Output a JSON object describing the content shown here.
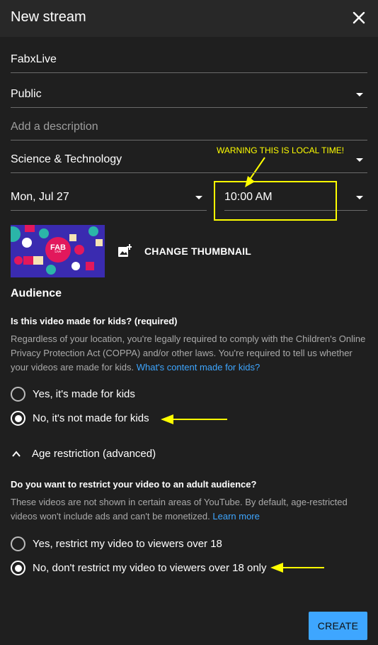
{
  "dialog": {
    "title": "New stream"
  },
  "form": {
    "title_value": "FabxLive",
    "visibility": "Public",
    "description_placeholder": "Add a description",
    "category": "Science & Technology",
    "date": "Mon, Jul 27",
    "time": "10:00 AM"
  },
  "annotation": {
    "warning": "WARNING THIS IS LOCAL TIME!",
    "color": "#ffff00"
  },
  "thumbnail": {
    "logo_text": "FAB",
    "logo_sub": "Live",
    "change_label": "CHANGE THUMBNAIL"
  },
  "audience": {
    "heading": "Audience",
    "question": "Is this video made for kids? (required)",
    "description": "Regardless of your location, you're legally required to comply with the Children's Online Privacy Protection Act (COPPA) and/or other laws. You're required to tell us whether your videos are made for kids.",
    "link": "What's content made for kids?",
    "options": [
      {
        "label": "Yes, it's made for kids",
        "selected": false
      },
      {
        "label": "No, it's not made for kids",
        "selected": true
      }
    ]
  },
  "age_restriction": {
    "toggle_label": "Age restriction (advanced)",
    "question": "Do you want to restrict your video to an adult audience?",
    "description": "These videos are not shown in certain areas of YouTube. By default, age-restricted videos won't include ads and can't be monetized.",
    "link": "Learn more",
    "options": [
      {
        "label": "Yes, restrict my video to viewers over 18",
        "selected": false
      },
      {
        "label": "No, don't restrict my video to viewers over 18 only",
        "selected": true
      }
    ]
  },
  "footer": {
    "create_label": "CREATE"
  },
  "colors": {
    "accent": "#3ea6ff",
    "background": "#1f1f1f",
    "header": "#282828"
  }
}
